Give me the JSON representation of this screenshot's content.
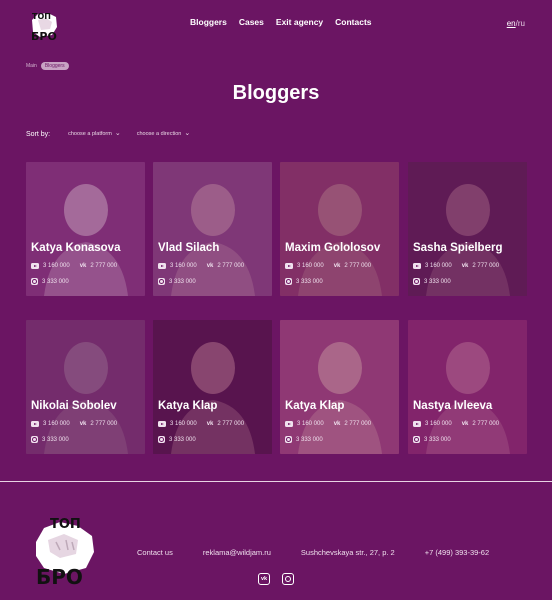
{
  "header": {
    "logo_text": "ТОП БРО",
    "nav": [
      "Bloggers",
      "Cases",
      "Exit agency",
      "Contacts"
    ],
    "lang_active": "en",
    "lang_sep": "/",
    "lang_other": "ru"
  },
  "breadcrumb": {
    "main": "Main",
    "current": "Bloggers"
  },
  "page_title": "Bloggers",
  "sort": {
    "label": "Sort by:",
    "platform": "choose a platform",
    "direction": "choose a direction"
  },
  "bloggers": [
    {
      "name": "Katya Konasova",
      "yt": "3 160 000",
      "vk": "2 777 000",
      "ig": "3 333 000",
      "tint": "#8a3d80",
      "tone": "#d7b7c9"
    },
    {
      "name": "Vlad Silach",
      "yt": "3 160 000",
      "vk": "2 777 000",
      "ig": "3 333 000",
      "tint": "#8b4a82",
      "tone": "#c59aa6"
    },
    {
      "name": "Maxim Gololosov",
      "yt": "3 160 000",
      "vk": "2 777 000",
      "ig": "3 333 000",
      "tint": "#8f3e68",
      "tone": "#b98586"
    },
    {
      "name": "Sasha Spielberg",
      "yt": "3 160 000",
      "vk": "2 777 000",
      "ig": "3 333 000",
      "tint": "#5a1f4d",
      "tone": "#a06a7e"
    },
    {
      "name": "Nikolai Sobolev",
      "yt": "3 160 000",
      "vk": "2 777 000",
      "ig": "3 333 000",
      "tint": "#7a3a70",
      "tone": "#9d7a93"
    },
    {
      "name": "Katya Klap",
      "yt": "3 160 000",
      "vk": "2 777 000",
      "ig": "3 333 000",
      "tint": "#4f1542",
      "tone": "#b07a87"
    },
    {
      "name": "Katya Klap",
      "yt": "3 160 000",
      "vk": "2 777 000",
      "ig": "3 333 000",
      "tint": "#a34c7d",
      "tone": "#dba9a8"
    },
    {
      "name": "Nastya Ivleeva",
      "yt": "3 160 000",
      "vk": "2 777 000",
      "ig": "3 333 000",
      "tint": "#8f2d6f",
      "tone": "#c47a98"
    }
  ],
  "vk_label": "vk",
  "footer": {
    "links": [
      "Contact us",
      "reklama@wildjam.ru",
      "Sushchevskaya str., 27, p. 2",
      "+7 (499) 393-39-62"
    ],
    "vk_label": "vk"
  },
  "colors": {
    "background": "#6b1563",
    "text": "#ffffff"
  }
}
